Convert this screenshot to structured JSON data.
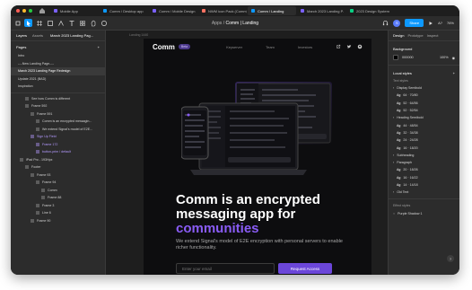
{
  "tabs": [
    {
      "label": "Mobile App",
      "color": "#7b61ff"
    },
    {
      "label": "Comm / Desktop app",
      "color": "#0d99ff"
    },
    {
      "label": "Comm / Mobile Design",
      "color": "#7b61ff"
    },
    {
      "label": "NWM icon Pack (Comm)",
      "color": "#ff7262"
    },
    {
      "label": "Comm / Landing",
      "color": "#0d99ff",
      "active": true
    },
    {
      "label": "March 2023 Landing P.",
      "color": "#7b61ff"
    },
    {
      "label": "2023 Design System",
      "color": "#0acf83"
    }
  ],
  "toolbar": {
    "breadcrumb": "Apps",
    "file": "Comm | Landing",
    "avatar": "S",
    "share": "Share",
    "zoom": "76%"
  },
  "left": {
    "tab_layers": "Layers",
    "tab_assets": "Assets",
    "page_name": "March 2023 Landing Pag...",
    "pages_label": "Pages",
    "pages": [
      {
        "label": "Intro"
      },
      {
        "label": "----New Landing Page----"
      },
      {
        "label": "March 2023 Landing Page Redesign",
        "selected": true
      },
      {
        "label": "Update 2021 (BAD)"
      },
      {
        "label": "Inspiration"
      }
    ],
    "layers": [
      {
        "label": "See how Comm is different",
        "indent": 4,
        "purple": false
      },
      {
        "label": "Frame 592",
        "indent": 4,
        "purple": false
      },
      {
        "label": "Frame 591",
        "indent": 6,
        "purple": false
      },
      {
        "label": "Comm is an encrypted messagin...",
        "indent": 8,
        "purple": false
      },
      {
        "label": "We extend Signal's model of E2E...",
        "indent": 8,
        "purple": false
      },
      {
        "label": "Sign Up Field",
        "indent": 6,
        "purple": true
      },
      {
        "label": "Frame 172",
        "indent": 8,
        "purple": true
      },
      {
        "label": "button-prim / default",
        "indent": 8,
        "purple": true
      },
      {
        "label": "iPad Pro - 193Hpx",
        "indent": 2,
        "purple": false
      },
      {
        "label": "Footer",
        "indent": 4,
        "purple": false
      },
      {
        "label": "Frame 93",
        "indent": 6,
        "purple": false
      },
      {
        "label": "Frame 94",
        "indent": 8,
        "purple": false
      },
      {
        "label": "Comm",
        "indent": 10,
        "purple": false
      },
      {
        "label": "Frame 88",
        "indent": 10,
        "purple": false
      },
      {
        "label": "Frame 3",
        "indent": 8,
        "purple": false
      },
      {
        "label": "Line 6",
        "indent": 8,
        "purple": false
      },
      {
        "label": "Frame 90",
        "indent": 6,
        "purple": false
      }
    ]
  },
  "canvas": {
    "frame_label": "Landing 1440",
    "site": {
      "logo": "Comm",
      "beta": "Beta",
      "nav": [
        "Keyserver",
        "Team",
        "Investors"
      ],
      "headline_1": "Comm is an encrypted",
      "headline_2": "messaging app for",
      "headline_accent": "communities",
      "sub": "We extend Signal's model of E2E encryption with personal servers to enable richer functionality.",
      "email_placeholder": "Enter your email",
      "cta": "Request Access"
    }
  },
  "right": {
    "tab_design": "Design",
    "tab_prototype": "Prototype",
    "tab_inspect": "Inspect",
    "background_label": "Background",
    "bg_hex": "000000",
    "bg_opacity": "100%",
    "local_styles_label": "Local styles",
    "text_styles_label": "Text styles",
    "groups": [
      {
        "label": "Display Semibold",
        "styles": [
          {
            "name": "64 · 70/80"
          },
          {
            "name": "52 · 64/56"
          },
          {
            "name": "52 · 52/54"
          }
        ]
      },
      {
        "label": "Heading Semibold",
        "styles": [
          {
            "name": "44 · 48/54"
          },
          {
            "name": "32 · 34/38"
          },
          {
            "name": "24 · 24/28"
          },
          {
            "name": "16 · 18/20"
          }
        ]
      },
      {
        "label": "Subheading",
        "styles": []
      },
      {
        "label": "Paragraph",
        "styles": [
          {
            "name": "20 · 18/26"
          },
          {
            "name": "16 · 16/22"
          },
          {
            "name": "14 · 14/18"
          }
        ]
      },
      {
        "label": "Old Text",
        "styles": []
      }
    ],
    "effect_label": "Effect styles",
    "effect": "Purple Shadow 1",
    "help": "?"
  }
}
